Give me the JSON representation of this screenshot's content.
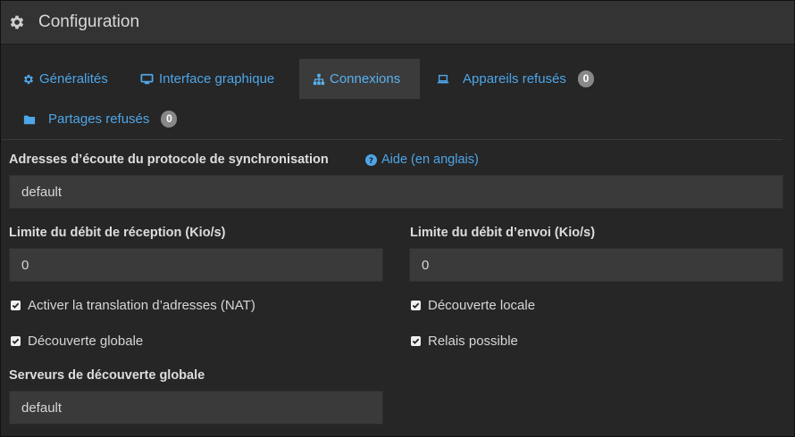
{
  "header": {
    "title": "Configuration",
    "icon": "gear-icon"
  },
  "tabs": [
    {
      "label": "Généralités",
      "icon": "gear-icon",
      "active": false
    },
    {
      "label": "Interface graphique",
      "icon": "desktop-icon",
      "active": false
    },
    {
      "label": "Connexions",
      "icon": "sitemap-icon",
      "active": true
    },
    {
      "label": "Appareils refusés",
      "icon": "laptop-icon",
      "active": false,
      "badge": "0"
    },
    {
      "label": "Partages refusés",
      "icon": "folder-icon",
      "active": false,
      "badge": "0"
    }
  ],
  "sync": {
    "label": "Adresses d’écoute du protocole de synchronisation",
    "help": "Aide (en anglais)",
    "value": "default"
  },
  "recv": {
    "label": "Limite du débit de réception (Kio/s)",
    "value": "0"
  },
  "send": {
    "label": "Limite du débit d’envoi (Kio/s)",
    "value": "0"
  },
  "checks": {
    "nat": {
      "label": "Activer la translation d’adresses (NAT)",
      "checked": true
    },
    "local": {
      "label": "Découverte locale",
      "checked": true
    },
    "global": {
      "label": "Découverte globale",
      "checked": true
    },
    "relay": {
      "label": "Relais possible",
      "checked": true
    }
  },
  "servers": {
    "label": "Serveurs de découverte globale",
    "value": "default"
  },
  "colors": {
    "accent": "#4da6e8",
    "background": "#262626",
    "field": "#3a3a3a",
    "badge": "#888888"
  }
}
